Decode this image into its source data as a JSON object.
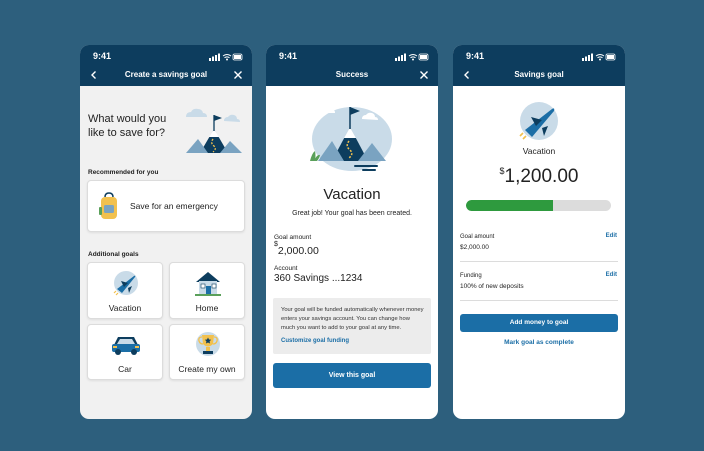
{
  "status_time": "9:41",
  "screens": {
    "create": {
      "title": "Create a savings goal",
      "headline": "What would you like to save for?",
      "recommended_label": "Recommended for you",
      "recommended_item": "Save for an emergency",
      "additional_label": "Additional goals",
      "goals": [
        "Vacation",
        "Home",
        "Car",
        "Create my own"
      ]
    },
    "success": {
      "title": "Success",
      "goal_name": "Vacation",
      "message": "Great job! Your goal has been created.",
      "goal_amount_label": "Goal amount",
      "goal_amount_currency": "$",
      "goal_amount_value": "2,000.00",
      "account_label": "Account",
      "account_value": "360 Savings ...1234",
      "info_text": "Your goal will be funded automatically whenever money enters your savings account. You can change how much you want to add to your goal at any time.",
      "info_link": "Customize goal funding",
      "button": "View this goal"
    },
    "savings": {
      "title": "Savings goal",
      "goal_name": "Vacation",
      "balance_currency": "$",
      "balance_value": "1,200.00",
      "progress": 0.6,
      "goal_amount_label": "Goal amount",
      "goal_amount_value": "$2,000.00",
      "edit_label": "Edit",
      "funding_label": "Funding",
      "funding_value": "100% of new deposits",
      "add_button": "Add money to goal",
      "complete_link": "Mark goal as complete"
    }
  },
  "colors": {
    "header": "#0d3d5e",
    "button": "#1b6ea6",
    "progress_fill": "#2e9a3e",
    "progress_track": "#dcdcdc",
    "background": "#2d5f7d"
  }
}
